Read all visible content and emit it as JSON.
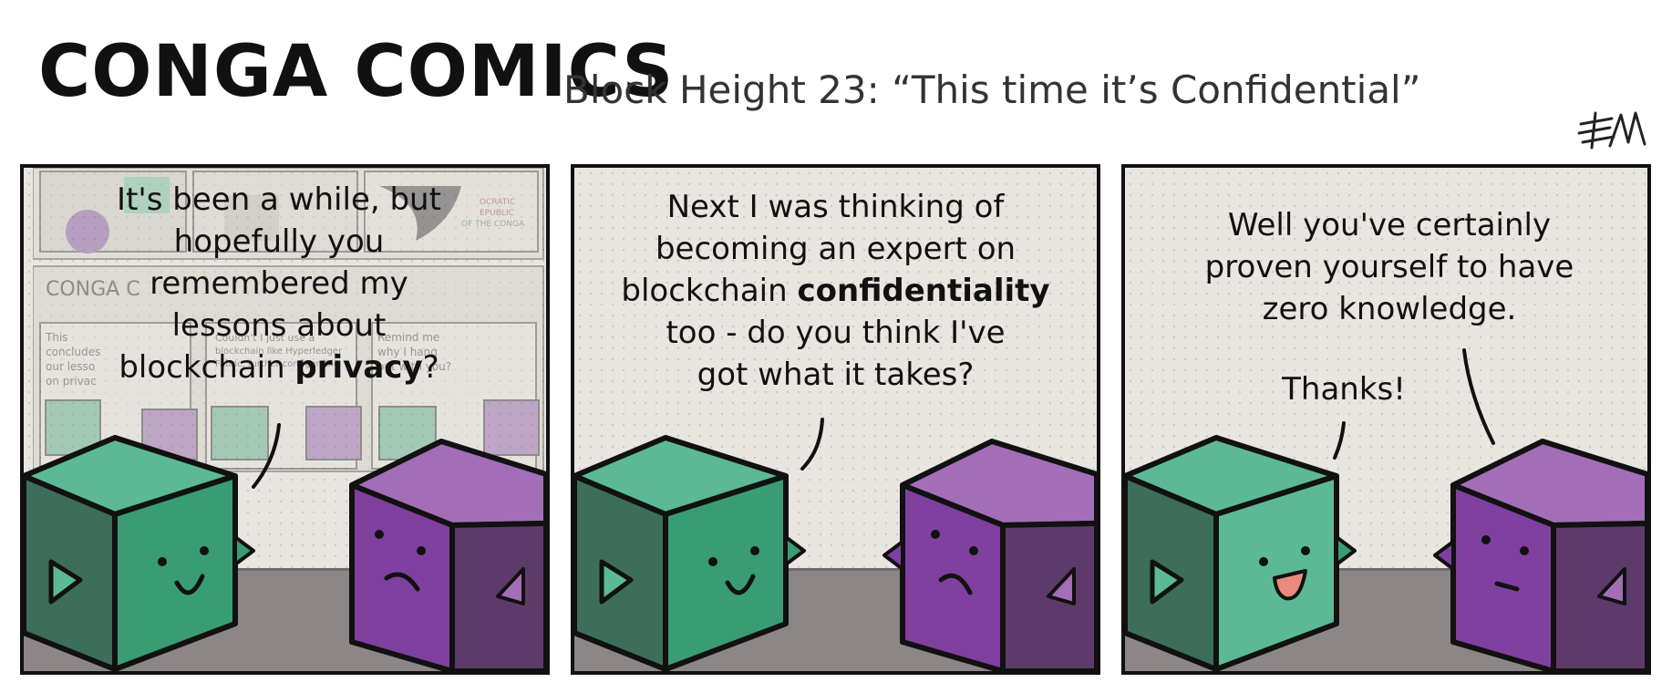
{
  "header": {
    "title": "CONGA COMICS",
    "subtitle": "Block Height 23: “This time it’s Confidential”"
  },
  "panels": [
    {
      "bubble": {
        "line1": "It's been a while, but",
        "line2": "hopefully you",
        "line3": "remembered my",
        "line4": "lessons about",
        "line5_pre": "blockchain ",
        "line5_bold": "privacy",
        "line5_post": "?"
      },
      "background_comic": {
        "title": "CONGA C",
        "text_a": "This",
        "text_b": "concludes",
        "text_c": "our lesso",
        "text_d": "on privac",
        "text_e": "Remind me",
        "text_f": "why I hang",
        "text_g": "out with you?",
        "text_h": "Couldn't I just use a",
        "text_i": "blockchain like Hyperledger",
        "text_j": "Fabric, further configurable",
        "text_k": "OCRATIC",
        "text_l": "EPUBLIC",
        "text_m": "OF THE CONGA"
      }
    },
    {
      "bubble": {
        "line1": "Next I was thinking of",
        "line2": "becoming an expert on",
        "line3_pre": "blockchain ",
        "line3_bold": "confidentiality",
        "line4": "too - do you think I've",
        "line5": "got what it takes?"
      }
    },
    {
      "bubble_purple": {
        "line1": "Well you've certainly",
        "line2": "proven yourself to have",
        "line3": "zero knowledge."
      },
      "bubble_green": {
        "text": "Thanks!"
      }
    }
  ],
  "colors": {
    "green_top": "#5cb995",
    "green_front": "#3a9c74",
    "green_side": "#3c6e5a",
    "purple_top": "#a46db7",
    "purple_front": "#7f40a0",
    "purple_side": "#5e3a6b",
    "floor": "#8c8687",
    "panel_bg": "#e9e6e1"
  }
}
